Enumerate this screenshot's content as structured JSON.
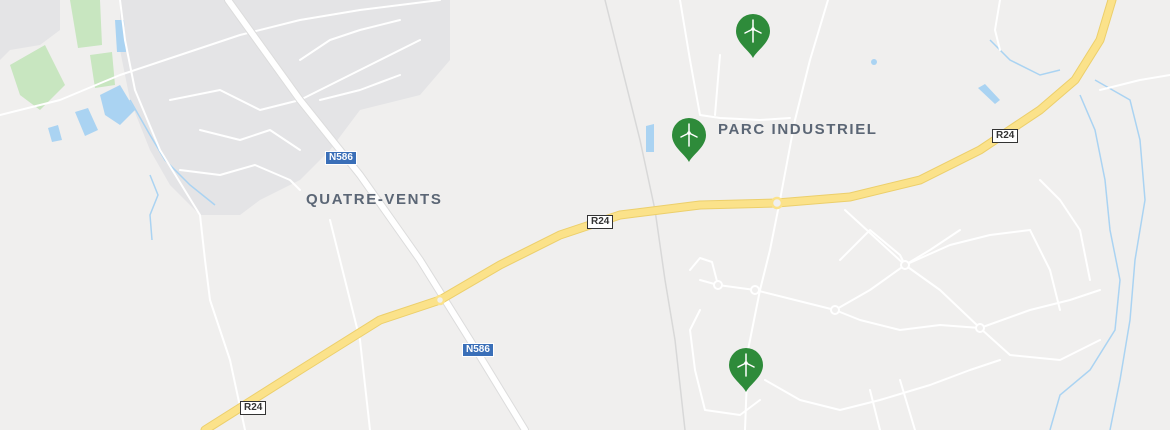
{
  "map": {
    "place_labels": {
      "quatre_vents": "QUATRE-VENTS",
      "parc_industriel": "PARC INDUSTRIEL"
    },
    "road_shields": {
      "r24_a": "R24",
      "r24_b": "R24",
      "r24_c": "R24",
      "n586_a": "N586",
      "n586_b": "N586"
    },
    "markers": [
      {
        "name": "wind-turbine-marker-1",
        "icon": "wind-turbine-icon"
      },
      {
        "name": "wind-turbine-marker-2",
        "icon": "wind-turbine-icon"
      },
      {
        "name": "wind-turbine-marker-3",
        "icon": "wind-turbine-icon"
      }
    ],
    "colors": {
      "land": "#f0efee",
      "urban": "#e4e4e6",
      "highway": "#fbe28a",
      "highway_casing": "#eccf6b",
      "major_road": "#ffffff",
      "water": "#aad3f2",
      "park": "#c8e6c0",
      "marker": "#2e8b3a"
    }
  }
}
